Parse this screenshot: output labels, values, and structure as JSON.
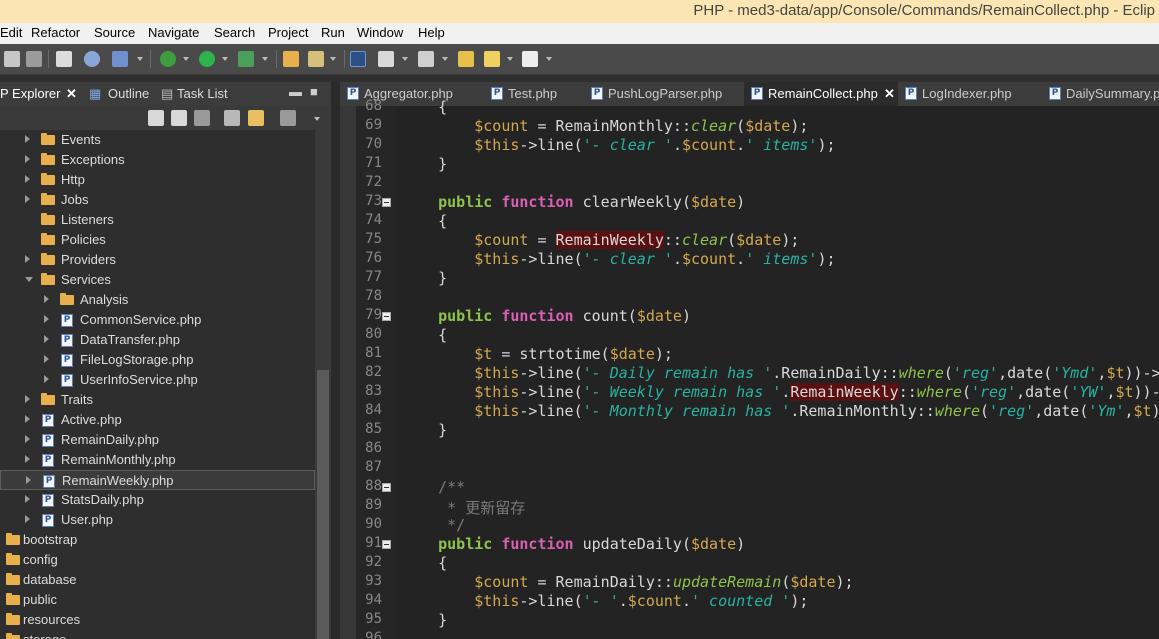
{
  "window": {
    "title": "PHP - med3-data/app/Console/Commands/RemainCollect.php - Eclip"
  },
  "menu": [
    "Edit",
    "Refactor",
    "Source",
    "Navigate",
    "Search",
    "Project",
    "Run",
    "Window",
    "Help"
  ],
  "left_panel": {
    "tabs": [
      {
        "label": "P Explorer",
        "active": true
      },
      {
        "label": "Outline",
        "active": false
      },
      {
        "label": "Task List",
        "active": false
      }
    ],
    "tree": [
      {
        "label": "Events",
        "type": "folder",
        "level": 1,
        "expanded": false
      },
      {
        "label": "Exceptions",
        "type": "folder",
        "level": 1,
        "expanded": false
      },
      {
        "label": "Http",
        "type": "folder",
        "level": 1,
        "expanded": false
      },
      {
        "label": "Jobs",
        "type": "folder",
        "level": 1,
        "expanded": false
      },
      {
        "label": "Listeners",
        "type": "folder",
        "level": 1,
        "expanded": null
      },
      {
        "label": "Policies",
        "type": "folder",
        "level": 1,
        "expanded": null
      },
      {
        "label": "Providers",
        "type": "folder",
        "level": 1,
        "expanded": false
      },
      {
        "label": "Services",
        "type": "folder",
        "level": 1,
        "expanded": true
      },
      {
        "label": "Analysis",
        "type": "folder",
        "level": 2,
        "expanded": false
      },
      {
        "label": "CommonService.php",
        "type": "file",
        "level": 2,
        "expanded": false
      },
      {
        "label": "DataTransfer.php",
        "type": "file",
        "level": 2,
        "expanded": false
      },
      {
        "label": "FileLogStorage.php",
        "type": "file",
        "level": 2,
        "expanded": false
      },
      {
        "label": "UserInfoService.php",
        "type": "file",
        "level": 2,
        "expanded": false
      },
      {
        "label": "Traits",
        "type": "folder",
        "level": 1,
        "expanded": false
      },
      {
        "label": "Active.php",
        "type": "file",
        "level": 1,
        "expanded": false
      },
      {
        "label": "RemainDaily.php",
        "type": "file",
        "level": 1,
        "expanded": false
      },
      {
        "label": "RemainMonthly.php",
        "type": "file",
        "level": 1,
        "expanded": false
      },
      {
        "label": "RemainWeekly.php",
        "type": "file",
        "level": 1,
        "expanded": false,
        "selected": true
      },
      {
        "label": "StatsDaily.php",
        "type": "file",
        "level": 1,
        "expanded": false
      },
      {
        "label": "User.php",
        "type": "file",
        "level": 1,
        "expanded": false
      },
      {
        "label": "bootstrap",
        "type": "folder",
        "level": 0,
        "expanded": null
      },
      {
        "label": "config",
        "type": "folder",
        "level": 0,
        "expanded": null
      },
      {
        "label": "database",
        "type": "folder",
        "level": 0,
        "expanded": null
      },
      {
        "label": "public",
        "type": "folder",
        "level": 0,
        "expanded": null
      },
      {
        "label": "resources",
        "type": "folder",
        "level": 0,
        "expanded": null
      },
      {
        "label": "storage",
        "type": "folder",
        "level": 0,
        "expanded": null
      }
    ]
  },
  "editor": {
    "tabs": [
      {
        "label": "Aggregator.php",
        "active": false
      },
      {
        "label": "Test.php",
        "active": false
      },
      {
        "label": "PushLogParser.php",
        "active": false
      },
      {
        "label": "RemainCollect.php",
        "active": true
      },
      {
        "label": "LogIndexer.php",
        "active": false
      },
      {
        "label": "DailySummary.php",
        "active": false
      }
    ],
    "lines": [
      {
        "n": "68",
        "fold": false,
        "code": [
          {
            "t": "    {"
          }
        ]
      },
      {
        "n": "69",
        "fold": false,
        "code": [
          {
            "t": "        "
          },
          {
            "t": "$count",
            "c": "v"
          },
          {
            "t": " = RemainMonthly::"
          },
          {
            "t": "clear",
            "c": "i"
          },
          {
            "t": "("
          },
          {
            "t": "$date",
            "c": "v"
          },
          {
            "t": ");"
          }
        ]
      },
      {
        "n": "70",
        "fold": false,
        "code": [
          {
            "t": "        "
          },
          {
            "t": "$this",
            "c": "v"
          },
          {
            "t": "->line("
          },
          {
            "t": "'- clear '",
            "c": "s"
          },
          {
            "t": "."
          },
          {
            "t": "$count",
            "c": "v"
          },
          {
            "t": "."
          },
          {
            "t": "' items'",
            "c": "s"
          },
          {
            "t": ");"
          }
        ]
      },
      {
        "n": "71",
        "fold": false,
        "code": [
          {
            "t": "    }"
          }
        ]
      },
      {
        "n": "72",
        "fold": false,
        "code": []
      },
      {
        "n": "73",
        "fold": true,
        "code": [
          {
            "t": "    "
          },
          {
            "t": "public",
            "c": "k"
          },
          {
            "t": " "
          },
          {
            "t": "function",
            "c": "f"
          },
          {
            "t": " clearWeekly("
          },
          {
            "t": "$date",
            "c": "v"
          },
          {
            "t": ")"
          }
        ]
      },
      {
        "n": "74",
        "fold": false,
        "code": [
          {
            "t": "    {"
          }
        ]
      },
      {
        "n": "75",
        "fold": false,
        "code": [
          {
            "t": "        "
          },
          {
            "t": "$count",
            "c": "v"
          },
          {
            "t": " = "
          },
          {
            "t": "RemainWeekly",
            "c": "h"
          },
          {
            "t": "::"
          },
          {
            "t": "clear",
            "c": "i"
          },
          {
            "t": "("
          },
          {
            "t": "$date",
            "c": "v"
          },
          {
            "t": ");"
          }
        ]
      },
      {
        "n": "76",
        "fold": false,
        "code": [
          {
            "t": "        "
          },
          {
            "t": "$this",
            "c": "v"
          },
          {
            "t": "->line("
          },
          {
            "t": "'- clear '",
            "c": "s"
          },
          {
            "t": "."
          },
          {
            "t": "$count",
            "c": "v"
          },
          {
            "t": "."
          },
          {
            "t": "' items'",
            "c": "s"
          },
          {
            "t": ");"
          }
        ]
      },
      {
        "n": "77",
        "fold": false,
        "code": [
          {
            "t": "    }"
          }
        ]
      },
      {
        "n": "78",
        "fold": false,
        "code": []
      },
      {
        "n": "79",
        "fold": true,
        "code": [
          {
            "t": "    "
          },
          {
            "t": "public",
            "c": "k"
          },
          {
            "t": " "
          },
          {
            "t": "function",
            "c": "f"
          },
          {
            "t": " count("
          },
          {
            "t": "$date",
            "c": "v"
          },
          {
            "t": ")"
          }
        ]
      },
      {
        "n": "80",
        "fold": false,
        "code": [
          {
            "t": "    {"
          }
        ]
      },
      {
        "n": "81",
        "fold": false,
        "code": [
          {
            "t": "        "
          },
          {
            "t": "$t",
            "c": "v"
          },
          {
            "t": " = strtotime("
          },
          {
            "t": "$date",
            "c": "v"
          },
          {
            "t": ");"
          }
        ]
      },
      {
        "n": "82",
        "fold": false,
        "code": [
          {
            "t": "        "
          },
          {
            "t": "$this",
            "c": "v"
          },
          {
            "t": "->line("
          },
          {
            "t": "'- Daily remain has '",
            "c": "s"
          },
          {
            "t": ".RemainDaily::"
          },
          {
            "t": "where",
            "c": "i"
          },
          {
            "t": "("
          },
          {
            "t": "'reg'",
            "c": "s"
          },
          {
            "t": ",date("
          },
          {
            "t": "'Ymd'",
            "c": "s"
          },
          {
            "t": ","
          },
          {
            "t": "$t",
            "c": "v"
          },
          {
            "t": "))->c"
          }
        ]
      },
      {
        "n": "83",
        "fold": false,
        "code": [
          {
            "t": "        "
          },
          {
            "t": "$this",
            "c": "v"
          },
          {
            "t": "->line("
          },
          {
            "t": "'- Weekly remain has '",
            "c": "s"
          },
          {
            "t": "."
          },
          {
            "t": "RemainWeekly",
            "c": "h"
          },
          {
            "t": "::"
          },
          {
            "t": "where",
            "c": "i"
          },
          {
            "t": "("
          },
          {
            "t": "'reg'",
            "c": "s"
          },
          {
            "t": ",date("
          },
          {
            "t": "'YW'",
            "c": "s"
          },
          {
            "t": ","
          },
          {
            "t": "$t",
            "c": "v"
          },
          {
            "t": "))->"
          }
        ]
      },
      {
        "n": "84",
        "fold": false,
        "code": [
          {
            "t": "        "
          },
          {
            "t": "$this",
            "c": "v"
          },
          {
            "t": "->line("
          },
          {
            "t": "'- Monthly remain has '",
            "c": "s"
          },
          {
            "t": ".RemainMonthly::"
          },
          {
            "t": "where",
            "c": "i"
          },
          {
            "t": "("
          },
          {
            "t": "'reg'",
            "c": "s"
          },
          {
            "t": ",date("
          },
          {
            "t": "'Ym'",
            "c": "s"
          },
          {
            "t": ","
          },
          {
            "t": "$t",
            "c": "v"
          },
          {
            "t": "))"
          }
        ]
      },
      {
        "n": "85",
        "fold": false,
        "code": [
          {
            "t": "    }"
          }
        ]
      },
      {
        "n": "86",
        "fold": false,
        "code": []
      },
      {
        "n": "87",
        "fold": false,
        "code": []
      },
      {
        "n": "88",
        "fold": true,
        "code": [
          {
            "t": "    /**",
            "c": "c"
          }
        ]
      },
      {
        "n": "89",
        "fold": false,
        "code": [
          {
            "t": "     * 更新留存",
            "c": "c"
          }
        ]
      },
      {
        "n": "90",
        "fold": false,
        "code": [
          {
            "t": "     */",
            "c": "c"
          }
        ]
      },
      {
        "n": "91",
        "fold": true,
        "code": [
          {
            "t": "    "
          },
          {
            "t": "public",
            "c": "k"
          },
          {
            "t": " "
          },
          {
            "t": "function",
            "c": "f"
          },
          {
            "t": " updateDaily("
          },
          {
            "t": "$date",
            "c": "v"
          },
          {
            "t": ")"
          }
        ]
      },
      {
        "n": "92",
        "fold": false,
        "code": [
          {
            "t": "    {"
          }
        ]
      },
      {
        "n": "93",
        "fold": false,
        "code": [
          {
            "t": "        "
          },
          {
            "t": "$count",
            "c": "v"
          },
          {
            "t": " = RemainDaily::"
          },
          {
            "t": "updateRemain",
            "c": "i"
          },
          {
            "t": "("
          },
          {
            "t": "$date",
            "c": "v"
          },
          {
            "t": ");"
          }
        ]
      },
      {
        "n": "94",
        "fold": false,
        "code": [
          {
            "t": "        "
          },
          {
            "t": "$this",
            "c": "v"
          },
          {
            "t": "->line("
          },
          {
            "t": "'- '",
            "c": "s"
          },
          {
            "t": "."
          },
          {
            "t": "$count",
            "c": "v"
          },
          {
            "t": "."
          },
          {
            "t": "' counted '",
            "c": "s"
          },
          {
            "t": ");"
          }
        ]
      },
      {
        "n": "95",
        "fold": false,
        "code": [
          {
            "t": "    }"
          }
        ]
      },
      {
        "n": "96",
        "fold": false,
        "code": []
      }
    ]
  }
}
